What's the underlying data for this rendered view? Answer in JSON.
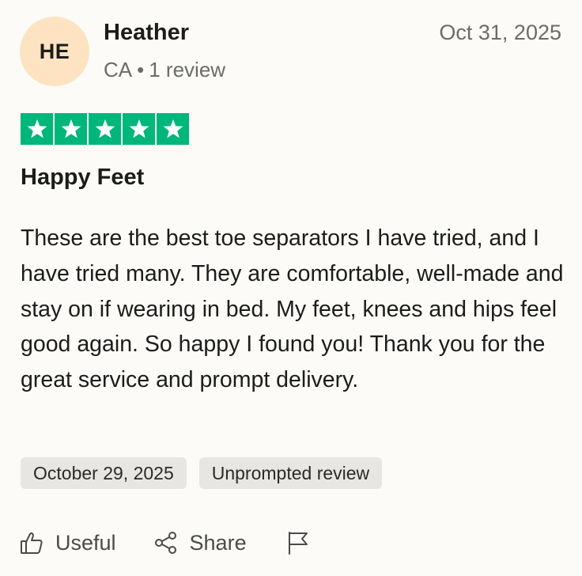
{
  "reviewer": {
    "initials": "HE",
    "name": "Heather",
    "country": "CA",
    "separator": "•",
    "review_count": "1 review"
  },
  "review": {
    "date": "Oct 31, 2025",
    "rating": 5,
    "rating_max": 5,
    "title": "Happy Feet",
    "body": "These are the best toe separators I have tried, and I have tried many. They are comfortable, well-made and stay on if wearing in bed. My feet, knees and hips feel good again. So happy I found you! Thank you for the great service and prompt delivery."
  },
  "tags": [
    {
      "label": "October 29, 2025"
    },
    {
      "label": "Unprompted review"
    }
  ],
  "actions": {
    "useful_label": "Useful",
    "share_label": "Share"
  },
  "colors": {
    "star_green": "#00b67a",
    "avatar_bg": "#fde3c2",
    "background": "#fcfbf8",
    "tag_bg": "#e7e6e2"
  },
  "icons": {
    "star": "star-icon",
    "useful": "thumbs-up-icon",
    "share": "share-icon",
    "report": "flag-icon"
  }
}
